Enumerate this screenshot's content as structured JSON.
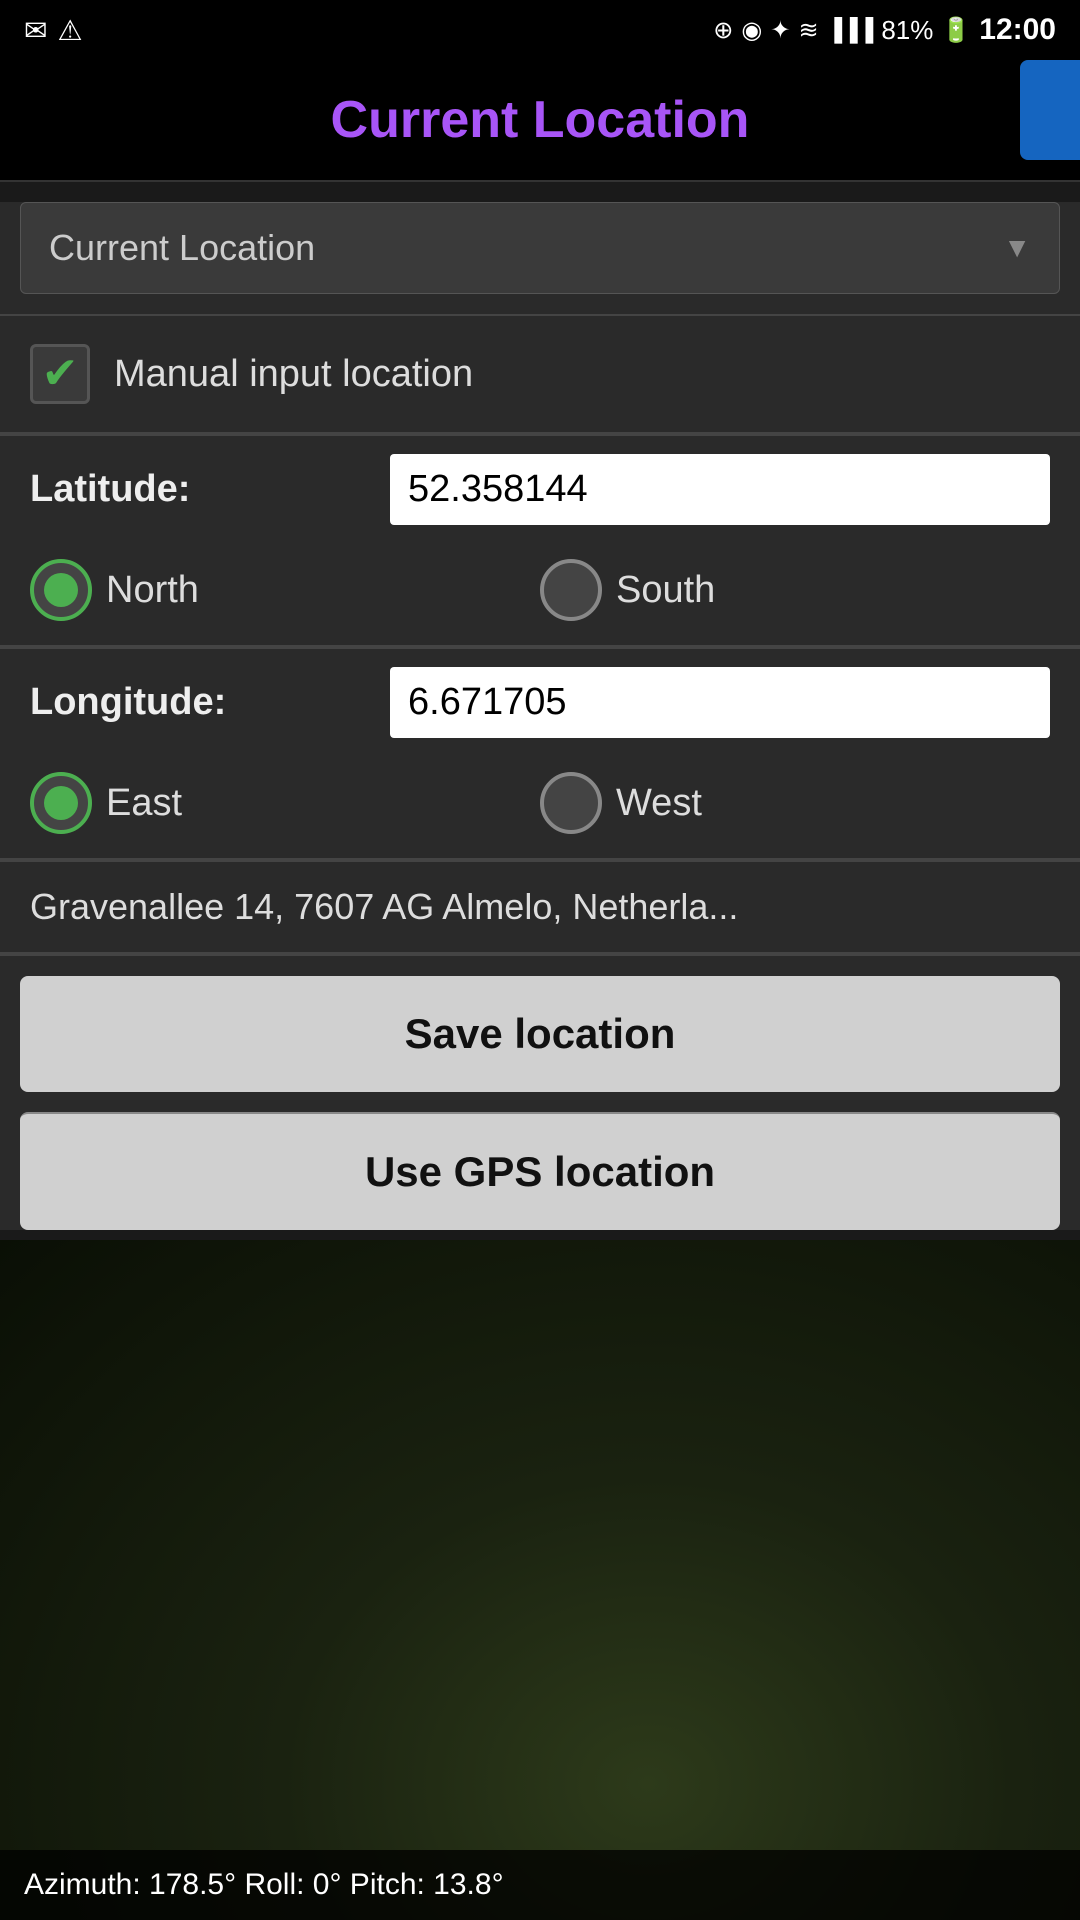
{
  "statusBar": {
    "leftIcons": [
      "✉",
      "⚠"
    ],
    "rightIcons": [
      "⊕",
      "◉",
      "✦",
      "≋",
      "▐▐▐",
      "81%",
      "🔋"
    ],
    "time": "12:00"
  },
  "header": {
    "title": "Current Location"
  },
  "dropdown": {
    "label": "Current Location",
    "arrow": "▼"
  },
  "manualInput": {
    "checkboxLabel": "Manual input location",
    "checked": true
  },
  "latitude": {
    "label": "Latitude:",
    "value": "52.358144"
  },
  "latitudeDirection": {
    "northLabel": "North",
    "southLabel": "South",
    "northSelected": true,
    "southSelected": false
  },
  "longitude": {
    "label": "Longitude:",
    "value": "6.671705"
  },
  "longitudeDirection": {
    "eastLabel": "East",
    "westLabel": "West",
    "eastSelected": true,
    "westSelected": false
  },
  "address": {
    "text": "Gravenallee 14, 7607 AG Almelo, Netherla..."
  },
  "buttons": {
    "saveLocation": "Save location",
    "useGps": "Use GPS location"
  },
  "bottomStatus": {
    "text": "Azimuth: 178.5° Roll:  0° Pitch: 13.8°"
  },
  "colors": {
    "accent": "#a855f7",
    "checkGreen": "#4caf50",
    "buttonBg": "#d0d0d0"
  }
}
